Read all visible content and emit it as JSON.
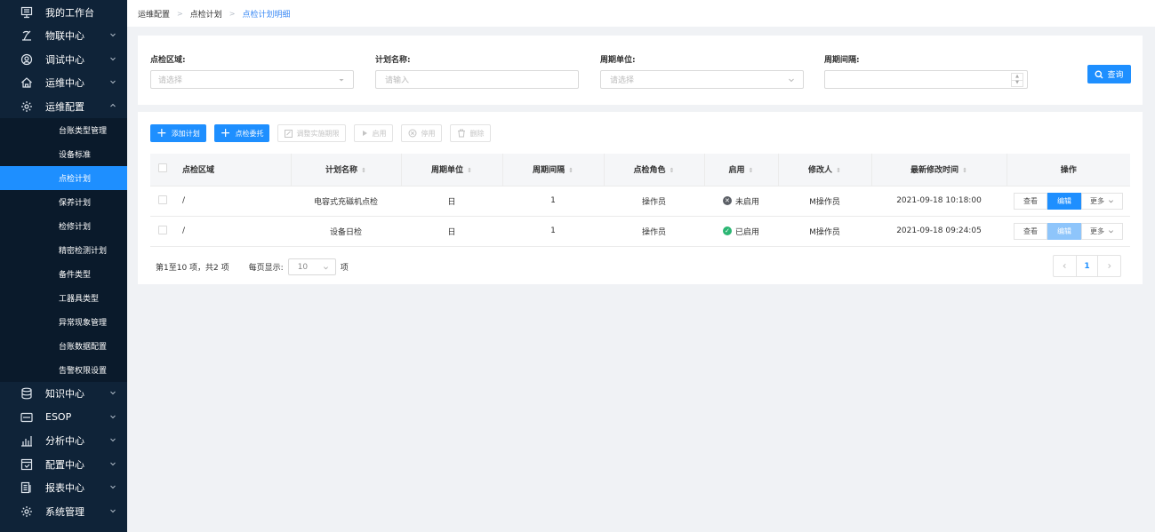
{
  "sidebar": {
    "top": {
      "label": "我的工作台",
      "icon": "monitor-icon"
    },
    "items_before": [
      {
        "label": "物联中心",
        "icon": "satellite-icon"
      },
      {
        "label": "调试中心",
        "icon": "debug-icon"
      },
      {
        "label": "运维中心",
        "icon": "home-icon"
      },
      {
        "label": "运维配置",
        "icon": "gear-icon",
        "expanded": true
      }
    ],
    "sub_items": [
      {
        "label": "台账类型管理"
      },
      {
        "label": "设备标准"
      },
      {
        "label": "点检计划",
        "active": true
      },
      {
        "label": "保养计划"
      },
      {
        "label": "检修计划"
      },
      {
        "label": "精密检测计划"
      },
      {
        "label": "备件类型"
      },
      {
        "label": "工器具类型"
      },
      {
        "label": "异常现象管理"
      },
      {
        "label": "台账数据配置"
      },
      {
        "label": "告警权限设置"
      }
    ],
    "items_after": [
      {
        "label": "知识中心",
        "icon": "database-icon"
      },
      {
        "label": "ESOP",
        "icon": "esop-icon"
      },
      {
        "label": "分析中心",
        "icon": "chart-icon"
      },
      {
        "label": "配置中心",
        "icon": "config-icon"
      },
      {
        "label": "报表中心",
        "icon": "report-icon"
      },
      {
        "label": "系统管理",
        "icon": "settings-icon"
      }
    ]
  },
  "breadcrumb": [
    "运维配置",
    "点检计划",
    "点检计划明细"
  ],
  "filters": {
    "area": {
      "label": "点检区域:",
      "placeholder": "请选择"
    },
    "name": {
      "label": "计划名称:",
      "placeholder": "请输入"
    },
    "unit": {
      "label": "周期单位:",
      "placeholder": "请选择"
    },
    "interval": {
      "label": "周期间隔:",
      "placeholder": ""
    },
    "query_label": "查询"
  },
  "toolbar": {
    "add_plan": "添加计划",
    "add_delegate": "点检委托",
    "adjust_period": "调整实施期限",
    "enable": "启用",
    "disable": "停用",
    "delete": "删除"
  },
  "table": {
    "headers": [
      "点检区域",
      "计划名称",
      "周期单位",
      "周期间隔",
      "点检角色",
      "启用",
      "修改人",
      "最新修改时间",
      "操作"
    ],
    "rows": [
      {
        "area": "/",
        "name": "电容式充磁机点检",
        "unit": "日",
        "interval": "1",
        "role": "操作员",
        "status": "未启用",
        "status_color": "#5b5f66",
        "modifier": "M操作员",
        "time": "2021-09-18 10:18:00"
      },
      {
        "area": "/",
        "name": "设备日检",
        "unit": "日",
        "interval": "1",
        "role": "操作员",
        "status": "已启用",
        "status_color": "#2bb673",
        "modifier": "M操作员",
        "time": "2021-09-18 09:24:05"
      }
    ],
    "ops": {
      "view": "查看",
      "edit": "编辑",
      "more": "更多"
    }
  },
  "pagination": {
    "summary": "第1至10 项，共2 项",
    "per_page_label": "每页显示:",
    "per_page_value": "10",
    "per_page_unit": "项",
    "current_page": "1"
  },
  "colors": {
    "sidebar_bg": "#0f2338",
    "accent": "#1e8fff",
    "enabled": "#2bb673",
    "disabled": "#5b5f66"
  }
}
